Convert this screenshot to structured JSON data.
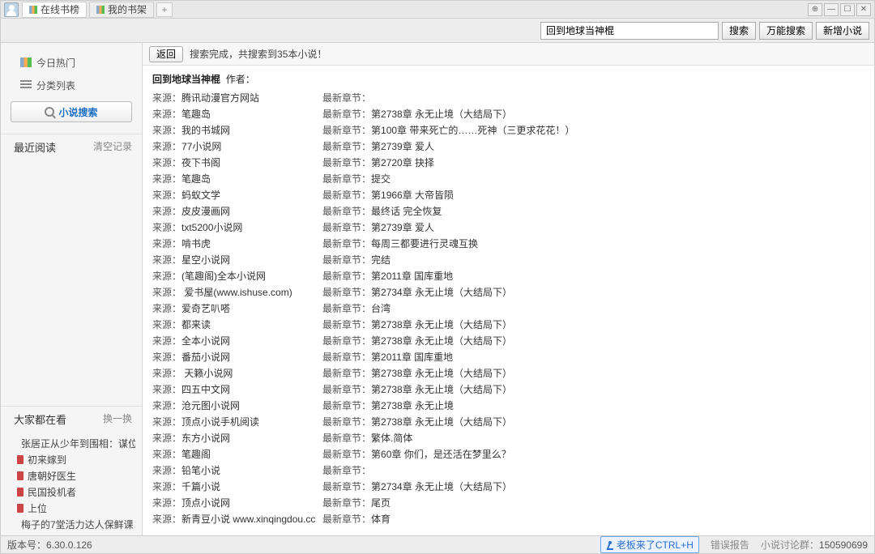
{
  "tabs": [
    {
      "label": "在线书榜"
    },
    {
      "label": "我的书架"
    }
  ],
  "search": {
    "value": "回到地球当神棍",
    "btn_search": "搜索",
    "btn_fullsearch": "万能搜索",
    "btn_new": "新增小说"
  },
  "sidebar": {
    "hot": "今日热门",
    "category": "分类列表",
    "search_label": "小说搜索",
    "recent_title": "最近阅读",
    "clear": "清空记录",
    "everyone_title": "大家都在看",
    "swap": "换一换",
    "books": [
      "张居正从少年到围相：谋位",
      "初来嫁到",
      "唐朝好医生",
      "民国投机者",
      "上位",
      "梅子的7堂活力达人保鲜课："
    ]
  },
  "main": {
    "back": "返回",
    "status": "搜索完成，共搜索到35本小说！",
    "title_bold": "回到地球当神棍",
    "author_label": "作者：",
    "src_label": "来源：",
    "chap_label": "最新章节：",
    "rows": [
      {
        "src": "腾讯动漫官方网站",
        "chap": ""
      },
      {
        "src": "笔趣岛",
        "chap": "第2738章 永无止境（大结局下）"
      },
      {
        "src": "我的书城网",
        "chap": "第100章 带来死亡的……死神（三更求花花！）"
      },
      {
        "src": "77小说网",
        "chap": "第2739章 爱人"
      },
      {
        "src": "夜下书阁",
        "chap": "第2720章 抉择"
      },
      {
        "src": "笔趣岛",
        "chap": "提交"
      },
      {
        "src": "蚂蚁文学",
        "chap": "第1966章 大帝皆陨"
      },
      {
        "src": "皮皮漫画网",
        "chap": "最终话 完全恢复"
      },
      {
        "src": "txt5200小说网",
        "chap": "第2739章 爱人"
      },
      {
        "src": "啃书虎",
        "chap": "每周三都要进行灵魂互换"
      },
      {
        "src": "星空小说网",
        "chap": "完结"
      },
      {
        "src": "(笔趣阁)全本小说网",
        "chap": "第2011章 国库重地"
      },
      {
        "src": " 爱书屋(www.ishuse.com)",
        "chap": "第2734章 永无止境（大结局下）"
      },
      {
        "src": "爱奇艺叭嗒",
        "chap": "台湾"
      },
      {
        "src": "都来读",
        "chap": "第2738章 永无止境（大结局下）"
      },
      {
        "src": "全本小说网",
        "chap": "第2738章 永无止境（大结局下）"
      },
      {
        "src": "番茄小说网",
        "chap": "第2011章 国库重地"
      },
      {
        "src": " 天籁小说网",
        "chap": "第2738章 永无止境（大结局下）"
      },
      {
        "src": "四五中文网",
        "chap": "第2738章 永无止境（大结局下）"
      },
      {
        "src": "沧元图小说网",
        "chap": "第2738章 永无止境"
      },
      {
        "src": "顶点小说手机阅读",
        "chap": "第2738章 永无止境（大结局下）"
      },
      {
        "src": "东方小说网",
        "chap": "繁体.简体"
      },
      {
        "src": "笔趣阁",
        "chap": "第60章 你们，是还活在梦里么？"
      },
      {
        "src": "铅笔小说",
        "chap": ""
      },
      {
        "src": "千篇小说",
        "chap": "第2734章 永无止境（大结局下）"
      },
      {
        "src": "顶点小说网",
        "chap": "尾页"
      },
      {
        "src": "新青豆小说 www.xinqingdou.cc",
        "chap": "体育"
      }
    ]
  },
  "footer": {
    "version": "版本号：6.30.0.126",
    "boss": "老板来了CTRL+H",
    "bug": "错误报告",
    "group_label": "小说讨论群：",
    "group_num": "150590699"
  }
}
